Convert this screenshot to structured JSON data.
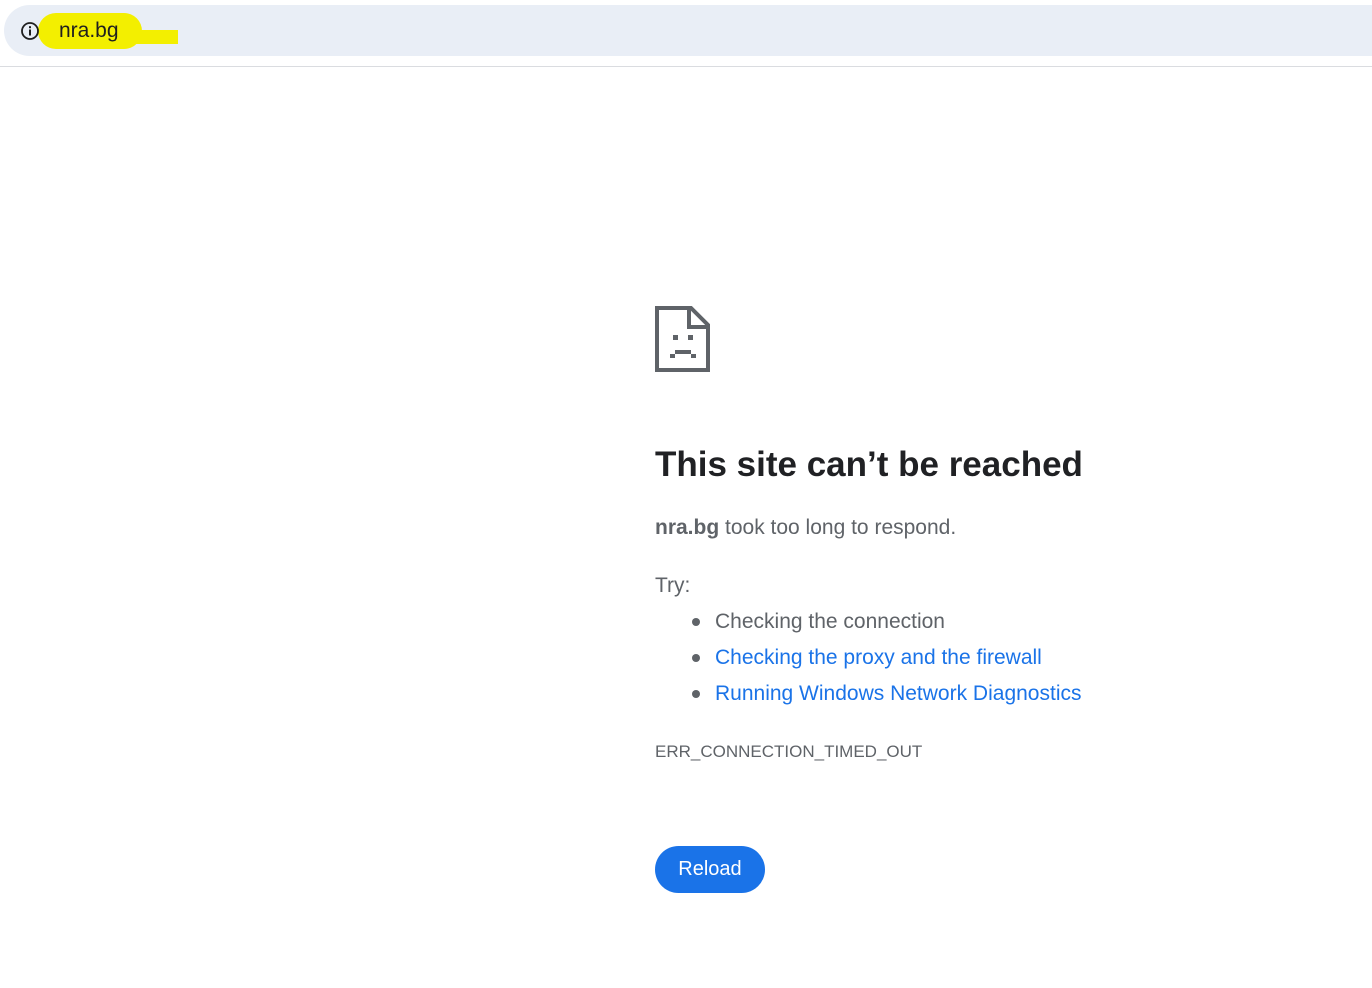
{
  "address_bar": {
    "url": "nra.bg",
    "site_info_icon": "info-icon",
    "highlight_color": "#f3ef00",
    "background_color": "#e9eef6"
  },
  "error_page": {
    "icon": "sad-document-icon",
    "title": "This site can’t be reached",
    "summary_host": "nra.bg",
    "summary_text": " took too long to respond.",
    "try_label": "Try:",
    "suggestions": [
      {
        "text": "Checking the connection",
        "is_link": false
      },
      {
        "text": "Checking the proxy and the firewall",
        "is_link": true
      },
      {
        "text": "Running Windows Network Diagnostics",
        "is_link": true
      }
    ],
    "error_code": "ERR_CONNECTION_TIMED_OUT",
    "reload_label": "Reload",
    "accent_color": "#1a73e8",
    "text_color": "#5f6368"
  }
}
